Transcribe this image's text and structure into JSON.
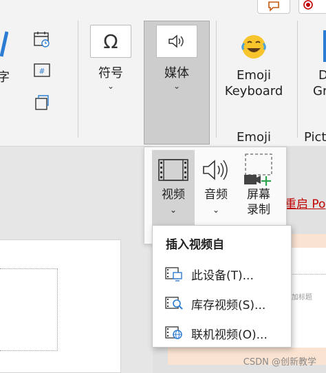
{
  "ribbon": {
    "partial_left_label": "字",
    "symbols": {
      "label": "符号"
    },
    "media": {
      "label": "媒体"
    },
    "emoji_keyboard": {
      "line1": "Emoji",
      "line2": "Keyboard"
    },
    "partial_right": {
      "line1": "D",
      "line2": "Gr"
    },
    "groups": {
      "emoji": "Emoji",
      "pict": "Pict"
    }
  },
  "document": {
    "restart_link": "重启 Po",
    "placeholder_hint": "加标题"
  },
  "media_dropdown": {
    "buttons": [
      {
        "line1": "视频",
        "line2": ""
      },
      {
        "line1": "音频",
        "line2": ""
      },
      {
        "line1": "屏幕",
        "line2": "录制"
      }
    ]
  },
  "video_submenu": {
    "title": "插入视频自",
    "items": [
      {
        "label": "此设备(T)...",
        "icon": "this-device-icon"
      },
      {
        "label": "库存视频(S)...",
        "icon": "stock-video-icon"
      },
      {
        "label": "联机视频(O)...",
        "icon": "online-video-icon"
      }
    ]
  },
  "watermark": "CSDN @创新教学",
  "colors": {
    "accent_blue": "#2b7cd3",
    "link_red": "#c00000",
    "plus_green": "#2da44e"
  }
}
